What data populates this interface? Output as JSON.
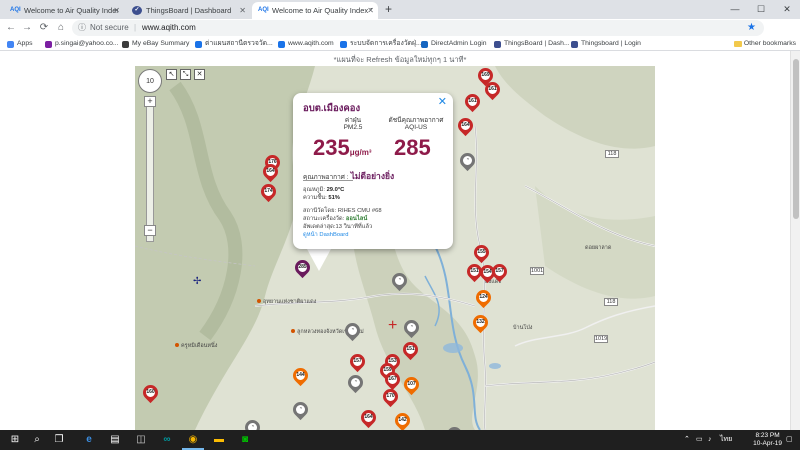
{
  "browser": {
    "tabs": [
      {
        "label": "Welcome to Air Quality Index Thai",
        "icon": "aqi-favicon",
        "active": false
      },
      {
        "label": "ThingsBoard | Dashboard",
        "icon": "thingsboard-favicon",
        "active": false
      },
      {
        "label": "Welcome to Air Quality Index Thai",
        "icon": "aqi-favicon",
        "active": true
      }
    ],
    "new_tab": "+",
    "window_controls": {
      "minimize": "—",
      "maximize": "☐",
      "close": "✕"
    },
    "nav": {
      "back": "←",
      "forward": "→",
      "reload": "⟳",
      "home": "⌂"
    },
    "security_label": "Not secure",
    "separator": "|",
    "url": "www.aqith.com",
    "star": "★",
    "menu": "⋮"
  },
  "bookmarks": {
    "items": [
      {
        "label": "Apps",
        "color": "#4285f4"
      },
      {
        "label": "p.singai@yahoo.co...",
        "color": "#7b1fa2"
      },
      {
        "label": "My eBay Summary",
        "color": "#3c3c3c"
      },
      {
        "label": "ต่าแผนสถานีตรวจวัด...",
        "color": "#1a73e8"
      },
      {
        "label": "www.aqith.com",
        "color": "#1a73e8"
      },
      {
        "label": "ระบบจัดการเครื่องวัดฝุ่...",
        "color": "#1a73e8"
      },
      {
        "label": "DirectAdmin Login",
        "color": "#1565c0"
      },
      {
        "label": "ThingsBoard | Dash...",
        "color": "#3d4f8f"
      },
      {
        "label": "Thingsboard | Login",
        "color": "#3d4f8f"
      }
    ],
    "other": "Other bookmarks"
  },
  "page": {
    "refresh_note": "*แผนที่จะ Refresh ข้อมูลใหม่ทุกๆ 1 นาที*"
  },
  "map": {
    "zoom_in": "+",
    "zoom_out": "−",
    "nav_ring": "10",
    "tools": [
      "↖",
      "⤡",
      "✕"
    ],
    "markers": [
      {
        "value": "169",
        "color": "#c62828"
      },
      {
        "value": "161",
        "color": "#c62828"
      },
      {
        "value": "161",
        "color": "#c62828"
      },
      {
        "value": "164",
        "color": "#c62828"
      },
      {
        "value": "176",
        "color": "#c62828"
      },
      {
        "value": "164",
        "color": "#c62828"
      },
      {
        "value": "174",
        "color": "#c62828"
      },
      {
        "value": "",
        "color": "#757575"
      },
      {
        "value": "285",
        "color": "#6a1b5d"
      },
      {
        "value": "155",
        "color": "#c62828"
      },
      {
        "value": "151",
        "color": "#c62828"
      },
      {
        "value": "154",
        "color": "#c62828"
      },
      {
        "value": "157",
        "color": "#c62828"
      },
      {
        "value": "124",
        "color": "#ef6c00"
      },
      {
        "value": "132",
        "color": "#ef6c00"
      },
      {
        "value": "",
        "color": "#757575"
      },
      {
        "value": "",
        "color": "#757575"
      },
      {
        "value": "",
        "color": "#757575"
      },
      {
        "value": "157",
        "color": "#c62828"
      },
      {
        "value": "153",
        "color": "#c62828"
      },
      {
        "value": "151",
        "color": "#c62828"
      },
      {
        "value": "159",
        "color": "#c62828"
      },
      {
        "value": "167",
        "color": "#c62828"
      },
      {
        "value": "107",
        "color": "#ef6c00"
      },
      {
        "value": "144",
        "color": "#ef6c00"
      },
      {
        "value": "",
        "color": "#757575"
      },
      {
        "value": "160",
        "color": "#c62828"
      },
      {
        "value": "170",
        "color": "#c62828"
      },
      {
        "value": "",
        "color": "#757575"
      },
      {
        "value": "164",
        "color": "#c62828"
      },
      {
        "value": "142",
        "color": "#ef6c00"
      },
      {
        "value": "",
        "color": "#757575"
      },
      {
        "value": "",
        "color": "#757575"
      }
    ],
    "road_shields": [
      "118",
      "1001",
      "118",
      "1019"
    ],
    "place_labels": [
      "อุทยานแห่งชาติผาแดง",
      "ลูกหลวงทองจังหวัดเชียงใหม่",
      "ครูหมิเดือนหนึ่ง",
      "ดงแดง",
      "บ้านโป่ง",
      "ดอยผาลาด"
    ]
  },
  "popup": {
    "station": "อบต.เมืองคอง",
    "pm_label": "ค่าฝุ่น",
    "pm_sub": "PM2.5",
    "aqi_label": "ดัชนีคุณภาพอากาศ",
    "aqi_sub": "AQI-US",
    "pm_value": "235",
    "pm_unit": "μg/m³",
    "aqi_value": "285",
    "quality_label": "คุณภาพอากาศ :",
    "quality_value": "ไม่ดีอย่างยิ่ง",
    "temp_label": "อุณหภูมิ:",
    "temp_value": "29.0°C",
    "hum_label": "ความชื้น:",
    "hum_value": "51%",
    "source_label": "สถานีวัดโดย:",
    "source_value": "RIHES CMU #68",
    "status_label": "สถานะเครื่องวัด:",
    "status_value": "ออนไลน์",
    "updated": "อัพเดตล่าสุด:13 วินาทีที่แล้ว",
    "link": "ดูหน้า DashBoard",
    "close": "✕"
  },
  "taskbar": {
    "start": "⊞",
    "search": "⌕",
    "taskview": "❐",
    "clock_time": "8:23 PM",
    "clock_date": "10-Apr-19",
    "lang": "ไทย"
  }
}
